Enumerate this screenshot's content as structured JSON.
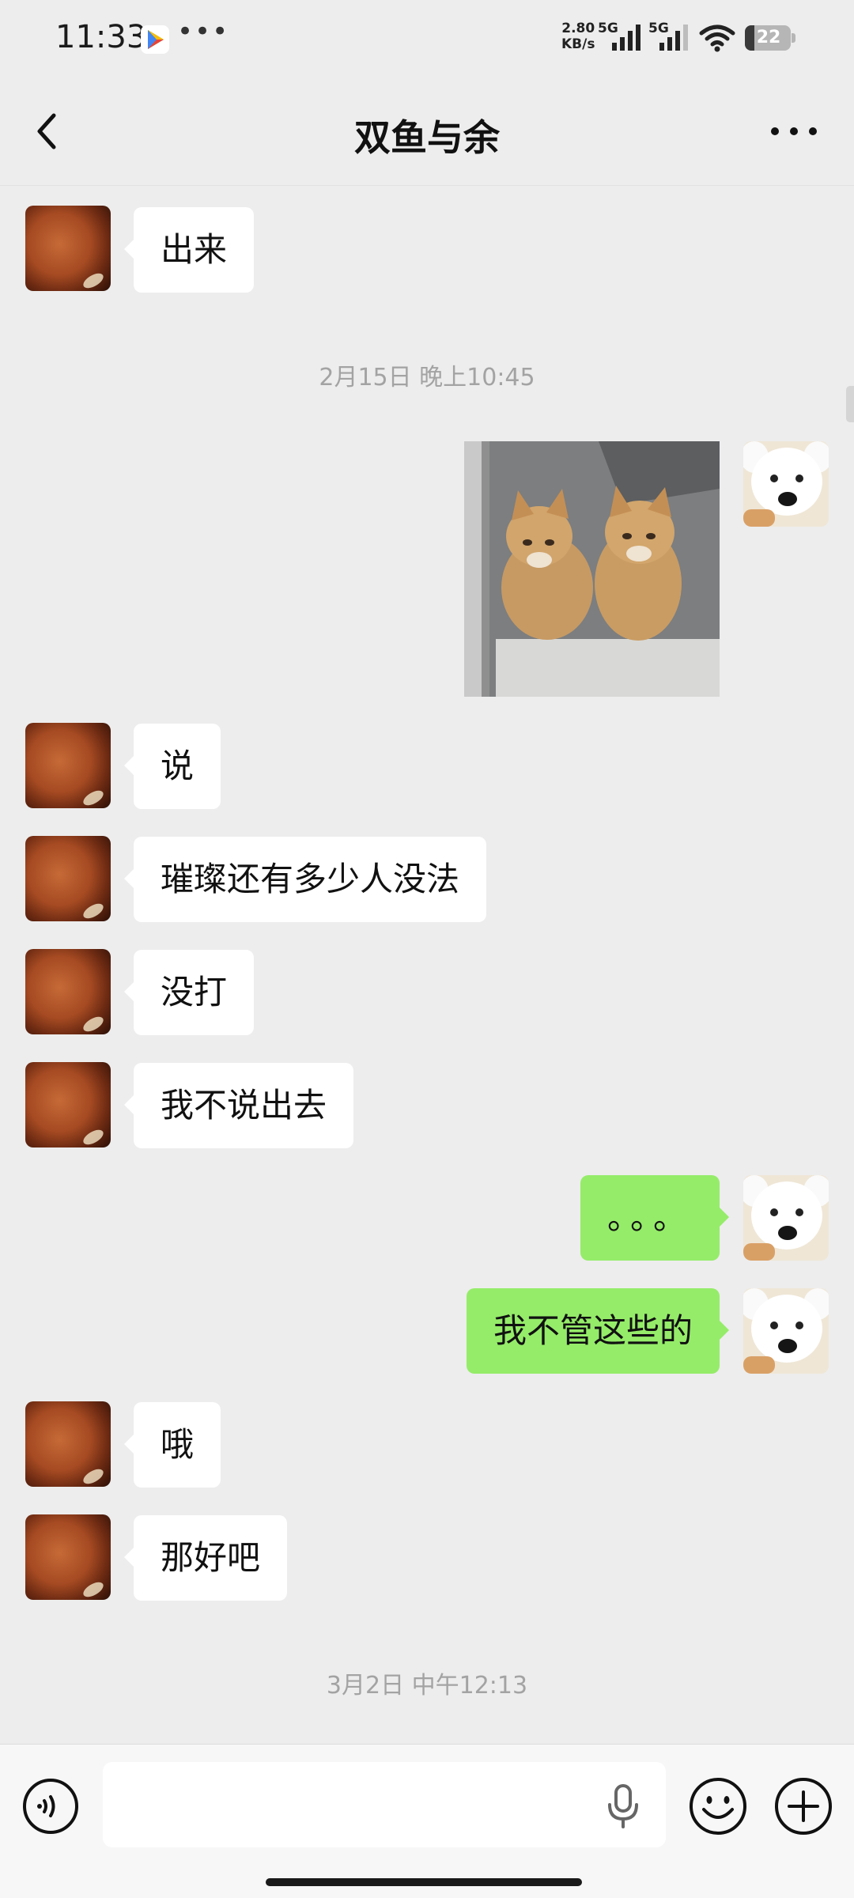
{
  "status_bar": {
    "time": "11:33",
    "more": "•••",
    "net_speed_value": "2.80",
    "net_speed_unit": "KB/s",
    "sim1_label": "5G",
    "sim2_label": "5G",
    "battery": "22",
    "icons": [
      "play-store-icon",
      "signal-icon",
      "wifi-icon",
      "battery-icon"
    ]
  },
  "header": {
    "title": "双鱼与余",
    "back_icon": "chevron-left-icon",
    "more_icon": "more-dots-icon"
  },
  "messages": [
    {
      "side": "left",
      "type": "text",
      "text": "出来"
    },
    {
      "type": "timestamp",
      "text": "2月15日 晚上10:45"
    },
    {
      "side": "right",
      "type": "image",
      "description_icon": "kittens-photo"
    },
    {
      "side": "left",
      "type": "text",
      "text": "说"
    },
    {
      "side": "left",
      "type": "text",
      "text": "璀璨还有多少人没法"
    },
    {
      "side": "left",
      "type": "text",
      "text": "没打"
    },
    {
      "side": "left",
      "type": "text",
      "text": "我不说出去"
    },
    {
      "side": "right",
      "type": "text",
      "text": "。。。"
    },
    {
      "side": "right",
      "type": "text",
      "text": "我不管这些的"
    },
    {
      "side": "left",
      "type": "text",
      "text": "哦"
    },
    {
      "side": "left",
      "type": "text",
      "text": "那好吧"
    },
    {
      "type": "timestamp",
      "text": "3月2日 中午12:13"
    }
  ],
  "input_bar": {
    "value": "",
    "placeholder": "",
    "icons": [
      "voice-icon",
      "microphone-icon",
      "emoji-icon",
      "plus-icon"
    ]
  },
  "colors": {
    "background": "#ededed",
    "own_bubble": "#95ec69",
    "other_bubble": "#ffffff",
    "timestamp": "#a3a3a3"
  }
}
